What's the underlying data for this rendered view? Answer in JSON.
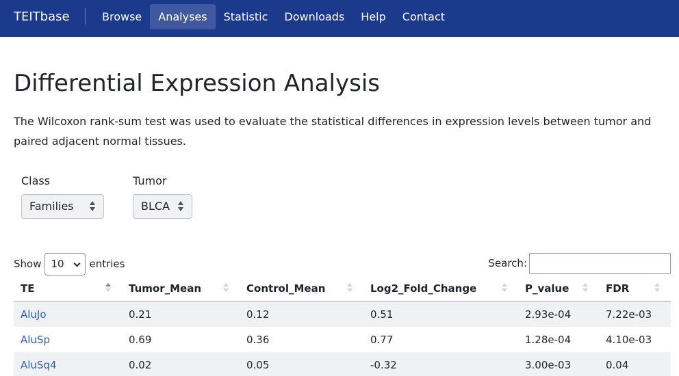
{
  "navbar": {
    "brand": "TEITbase",
    "links": [
      "Browse",
      "Analyses",
      "Statistic",
      "Downloads",
      "Help",
      "Contact"
    ],
    "active": "Analyses"
  },
  "page": {
    "title": "Differential Expression Analysis",
    "description": "The Wilcoxon rank-sum test was used to evaluate the statistical differences in expression levels between tumor and paired adjacent normal tissues."
  },
  "filters": {
    "class": {
      "label": "Class",
      "value": "Families"
    },
    "tumor": {
      "label": "Tumor",
      "value": "BLCA"
    }
  },
  "table_controls": {
    "show_label": "Show",
    "entries_value": "10",
    "entries_label": "entries",
    "search_label": "Search:"
  },
  "table": {
    "columns": [
      "TE",
      "Tumor_Mean",
      "Control_Mean",
      "Log2_Fold_Change",
      "P_value",
      "FDR"
    ],
    "rows": [
      [
        "AluJo",
        "0.21",
        "0.12",
        "0.51",
        "2.93e-04",
        "7.22e-03"
      ],
      [
        "AluSp",
        "0.69",
        "0.36",
        "0.77",
        "1.28e-04",
        "4.10e-03"
      ],
      [
        "AluSq4",
        "0.02",
        "0.05",
        "-0.32",
        "3.00e-03",
        "0.04"
      ]
    ]
  },
  "colors": {
    "navbar": "#1c3a8c",
    "link": "#2a5db0",
    "stripe": "#f0f1f3"
  }
}
